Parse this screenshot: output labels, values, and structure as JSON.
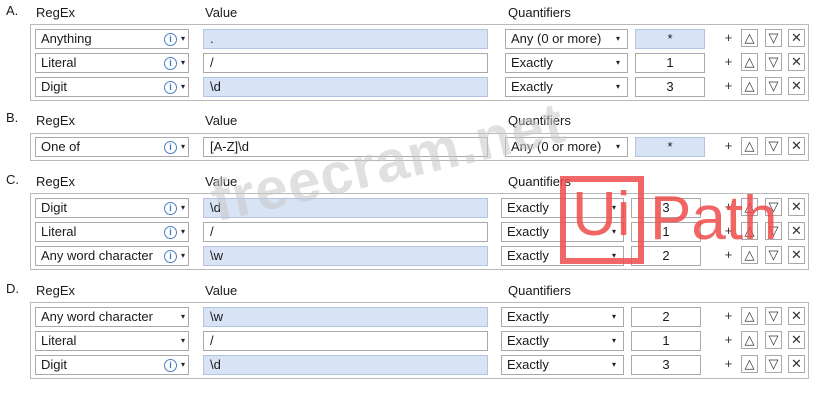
{
  "sections": [
    {
      "letter": "A.",
      "headers": {
        "regex": "RegEx",
        "value": "Value",
        "quantifiers": "Quantifiers"
      },
      "rows": [
        {
          "regex": "Anything",
          "value": ".",
          "quantifier": "Any (0 or more)",
          "count": "*"
        },
        {
          "regex": "Literal",
          "value": "/",
          "quantifier": "Exactly",
          "count": "1"
        },
        {
          "regex": "Digit",
          "value": "\\d",
          "quantifier": "Exactly",
          "count": "3"
        }
      ]
    },
    {
      "letter": "B.",
      "headers": {
        "regex": "RegEx",
        "value": "Value",
        "quantifiers": "Quantifiers"
      },
      "rows": [
        {
          "regex": "One of",
          "value": "[A-Z]\\d",
          "quantifier": "Any (0 or more)",
          "count": "*"
        }
      ]
    },
    {
      "letter": "C.",
      "headers": {
        "regex": "RegEx",
        "value": "Value",
        "quantifiers": "Quantifiers"
      },
      "rows": [
        {
          "regex": "Digit",
          "value": "\\d",
          "quantifier": "Exactly",
          "count": "3"
        },
        {
          "regex": "Literal",
          "value": "/",
          "quantifier": "Exactly",
          "count": "1"
        },
        {
          "regex": "Any word character",
          "value": "\\w",
          "quantifier": "Exactly",
          "count": "2"
        }
      ]
    },
    {
      "letter": "D.",
      "headers": {
        "regex": "RegEx",
        "value": "Value",
        "quantifiers": "Quantifiers"
      },
      "rows": [
        {
          "regex": "Any word character",
          "value": "\\w",
          "quantifier": "Exactly",
          "count": "2"
        },
        {
          "regex": "Literal",
          "value": "/",
          "quantifier": "Exactly",
          "count": "1"
        },
        {
          "regex": "Digit",
          "value": "\\d",
          "quantifier": "Exactly",
          "count": "3"
        }
      ]
    }
  ],
  "icons": {
    "info": "i",
    "caret": "▾",
    "add": "+",
    "up": "△",
    "down": "▽",
    "remove": "✕"
  },
  "watermark": {
    "text": "freecram.net",
    "logo_ui": "Ui",
    "logo_path": "Path"
  },
  "colors": {
    "value_field": "#d8e3f6",
    "logo_red": "#ef4b4b"
  }
}
